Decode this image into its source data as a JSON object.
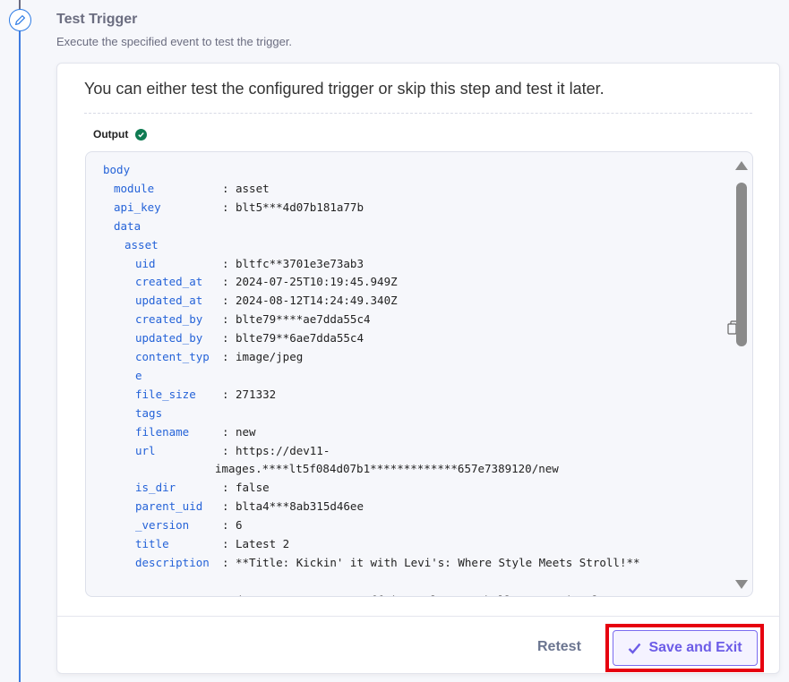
{
  "step": {
    "title": "Test Trigger",
    "subtitle": "Execute the specified event to test the trigger.",
    "icon": "pencil-icon"
  },
  "card": {
    "intro": "You can either test the configured trigger or skip this step and test it later.",
    "output_label": "Output",
    "output_status": "success"
  },
  "output_lines": [
    {
      "key": "body",
      "indent": 0,
      "value": null
    },
    {
      "key": "module",
      "indent": 1,
      "value": "asset"
    },
    {
      "key": "api_key",
      "indent": 1,
      "value": "blt5***4d07b181a77b"
    },
    {
      "key": "data",
      "indent": 1,
      "value": null
    },
    {
      "key": "asset",
      "indent": 2,
      "value": null
    },
    {
      "key": "uid",
      "indent": 3,
      "value": "bltfc**3701e3e73ab3"
    },
    {
      "key": "created_at",
      "indent": 3,
      "value": "2024-07-25T10:19:45.949Z"
    },
    {
      "key": "updated_at",
      "indent": 3,
      "value": "2024-08-12T14:24:49.340Z"
    },
    {
      "key": "created_by",
      "indent": 3,
      "value": "blte79****ae7dda55c4"
    },
    {
      "key": "updated_by",
      "indent": 3,
      "value": "blte79**6ae7dda55c4"
    },
    {
      "key": "content_typ",
      "indent": 3,
      "value": "image/jpeg"
    },
    {
      "key": "e",
      "indent": 3,
      "value": null
    },
    {
      "key": "file_size",
      "indent": 3,
      "value": "271332"
    },
    {
      "key": "tags",
      "indent": 3,
      "value": null
    },
    {
      "key": "filename",
      "indent": 3,
      "value": "new"
    },
    {
      "key": "url",
      "indent": 3,
      "value": "https://dev11-"
    },
    {
      "key": null,
      "indent": 3,
      "continuation": "images.****lt5f084d07b1*************657e7389120/new"
    },
    {
      "key": "is_dir",
      "indent": 3,
      "value": "false"
    },
    {
      "key": "parent_uid",
      "indent": 3,
      "value": "blta4***8ab315d46ee"
    },
    {
      "key": "_version",
      "indent": 3,
      "value": "6"
    },
    {
      "key": "title",
      "indent": 3,
      "value": "Latest 2"
    },
    {
      "key": "description",
      "indent": 3,
      "value": "**Title: Kickin' it with Levi's: Where Style Meets Stroll!**"
    },
    {
      "key": null,
      "indent": 3,
      "continuation": ""
    },
    {
      "key": null,
      "indent": 3,
      "continuation": "Ready to strut your stuff in style? Say hello to Levi's latest"
    }
  ],
  "footer": {
    "retest_label": "Retest",
    "save_label": "Save and Exit",
    "save_icon": "checkmark-icon"
  },
  "colors": {
    "accent": "#6c5ce7",
    "key": "#2563d8",
    "timeline": "#3f7be0",
    "success": "#0f7b52",
    "highlight": "#e6000f"
  }
}
